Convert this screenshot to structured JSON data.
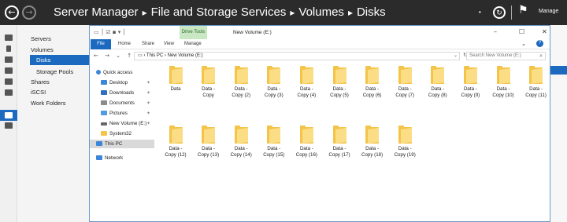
{
  "server_manager": {
    "breadcrumbs": [
      "Server Manager",
      "File and Storage Services",
      "Volumes",
      "Disks"
    ],
    "separator": "▸",
    "manage_label": "Manage",
    "nav": {
      "servers": "Servers",
      "volumes": "Volumes",
      "disks": "Disks",
      "storage_pools": "Storage Pools",
      "shares": "Shares",
      "iscsi": "iSCSI",
      "work_folders": "Work Folders"
    }
  },
  "explorer": {
    "drive_tools": "Drive Tools",
    "title": "New Volume (E:)",
    "ribbon_tabs": [
      "File",
      "Home",
      "Share",
      "View",
      "Manage"
    ],
    "address": [
      "This PC",
      "New Volume (E:)"
    ],
    "search_placeholder": "Search New Volume (E:)",
    "nav_pane": {
      "quick_access": "Quick access",
      "desktop": "Desktop",
      "downloads": "Downloads",
      "documents": "Documents",
      "pictures": "Pictures",
      "new_volume": "New Volume (E:)",
      "system32": "System32",
      "this_pc": "This PC",
      "network": "Network"
    },
    "files": [
      [
        "Data"
      ],
      [
        "Data -",
        "Copy"
      ],
      [
        "Data -",
        "Copy (2)"
      ],
      [
        "Data -",
        "Copy (3)"
      ],
      [
        "Data -",
        "Copy (4)"
      ],
      [
        "Data -",
        "Copy (5)"
      ],
      [
        "Data -",
        "Copy (6)"
      ],
      [
        "Data -",
        "Copy (7)"
      ],
      [
        "Data -",
        "Copy (8)"
      ],
      [
        "Data -",
        "Copy (9)"
      ],
      [
        "Data -",
        "Copy (10)"
      ],
      [
        "Data -",
        "Copy (11)"
      ],
      [
        "Data -",
        "Copy (12)"
      ],
      [
        "Data -",
        "Copy (13)"
      ],
      [
        "Data -",
        "Copy (14)"
      ],
      [
        "Data -",
        "Copy (15)"
      ],
      [
        "Data -",
        "Copy (16)"
      ],
      [
        "Data -",
        "Copy (17)"
      ],
      [
        "Data -",
        "Copy (18)"
      ],
      [
        "Data -",
        "Copy (19)"
      ]
    ]
  },
  "colors": {
    "accent": "#1b6ac0",
    "header_bg": "#2b2b2b",
    "folder": "#f3c447",
    "drive_tools_bg": "#c9e7c3"
  }
}
